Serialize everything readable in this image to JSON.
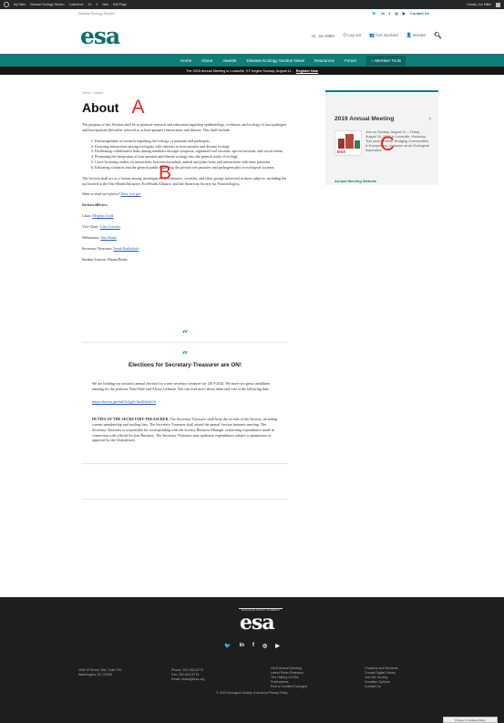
{
  "adminbar": {
    "items": [
      "My Sites",
      "Disease Ecology Section",
      "Customize",
      "13",
      "0",
      "New",
      "Edit Page"
    ],
    "user": "Howdy, Jon Miller"
  },
  "util": {
    "site_name": "Disease Ecology Section",
    "contact": "Contact Us"
  },
  "header": {
    "logo": "esa",
    "user": "Hi, Jon Miller",
    "logout": "Log out",
    "get_involved": "Get involved",
    "donate": "Donate"
  },
  "nav": {
    "items": [
      "Home",
      "About",
      "Awards",
      "Disease Ecology Section News",
      "Resources",
      "Forum"
    ],
    "member_tools": "Member Tools"
  },
  "announcement": {
    "text": "The 2019 Annual Meeting in Louisville, KY begins Sunday, August 11.",
    "link": "Register Now"
  },
  "main": {
    "breadcrumb": "Home > About",
    "title": "About",
    "intro": "The purpose of this Section shall be to promote research and education regarding epidemiology, evolution, and ecology of host-pathogen and host-parasite (hereafter referred to as host-parasite) interactions and disease. This shall include:",
    "objectives": [
      "Encouragement of research regarding the ecology of parasites and pathogens",
      "Fostering interactions among ecologists with interests in host-parasite and disease ecology",
      "Facilitating collaborative links among members through symposia, organized oral sessions, special sessions, and social events",
      "Promoting the integration of host-parasite and disease ecology into the general study of ecology",
      "Cross-fostering studies on interactions between microbial, animal and plant hosts and interactions with their parasites",
      "Educating scientists and the general public regarding the pivotal role parasites and pathogens play in ecological systems."
    ],
    "liaison": "The Section shall act as a liaison among investigators, practitioners, societies, and other groups interested in these subjects, including but not limited to the One Health Initiative, EcoHealth Alliance, and the American Society for Parasitologists.",
    "bylaws_text": "Want to read our bylaws?",
    "bylaws_link": "Here you go!",
    "officers_heading": "Section officers:",
    "officers": [
      {
        "role": "Chair:",
        "name": "Meghan Cook"
      },
      {
        "role": "Vice Chair:",
        "name": "Clay Cressler"
      },
      {
        "role": "Webmaster:",
        "name": "Ana Bento"
      },
      {
        "role": "Secretary-Treasurer:",
        "name": "Sarah Budischak"
      }
    ],
    "student_liaison": "Student Liaison: Briana Betke"
  },
  "card": {
    "quote": "“",
    "title": "Elections for Secretary-Treasurer are ON!",
    "p1": "We are holding our section's annual election for a new secretary treasurer for 2019-2020. We have two great candidates running for the position, Nina Wale and Alyssa Gehman. You can read more about them and vote at the following link:",
    "link": "https://forms.gle/b879Zyj9Y5z49Wd876",
    "duties_heading": "DUTIES OF THE SECRETARY-TREASURER.",
    "duties": "The Secretary-Treasurer shall keep the records of the Section, including current membership and mailing lists. The Secretary-Treasurer shall attend the annual Section business meeting. The Secretary-Treasurer is responsible for corresponding with the Society Business Manager concerning expenditures made in connection with official Section Business. The Secretary-Treasurer may authorize expenditures subject to permission or approval by the Chairperson."
  },
  "sidebar": {
    "heading": "2019 Annual Meeting",
    "text": "Join us Sunday, August 11 – Friday, August 16, 2019 in Louisville, Kentucky. This year's theme: Bridging Communities & Ecosystems: Inclusion as an Ecological Imperative",
    "thumb_label": "ESA",
    "link": "Annual Meeting Website"
  },
  "footer": {
    "logo": "esa",
    "logo_tag": "ECOLOGICAL SOCIETY OF AMERICA",
    "address": [
      "1990 M Street, NW, Suite 700",
      "Washington, DC 20036"
    ],
    "contact": [
      "Phone: 202-833-8773",
      "Fax: 202-833-8775",
      "Email: esahq@esa.org"
    ],
    "links1": [
      "2019 Annual Meeting",
      "Latest Press Releases",
      "The History of ESA",
      "Publications",
      "Find a Certified Ecologist"
    ],
    "links2": [
      "Chapters and Sections",
      "Crucial Digital Library",
      "Join the Society",
      "Donation Options",
      "Contact Us"
    ],
    "copyright": "© 2019 Ecological Society of America",
    "privacy": "Privacy Policy",
    "cookie": "Privacy & Cookies Policy"
  },
  "markers": {
    "a": "A",
    "b": "B",
    "c": "C"
  }
}
